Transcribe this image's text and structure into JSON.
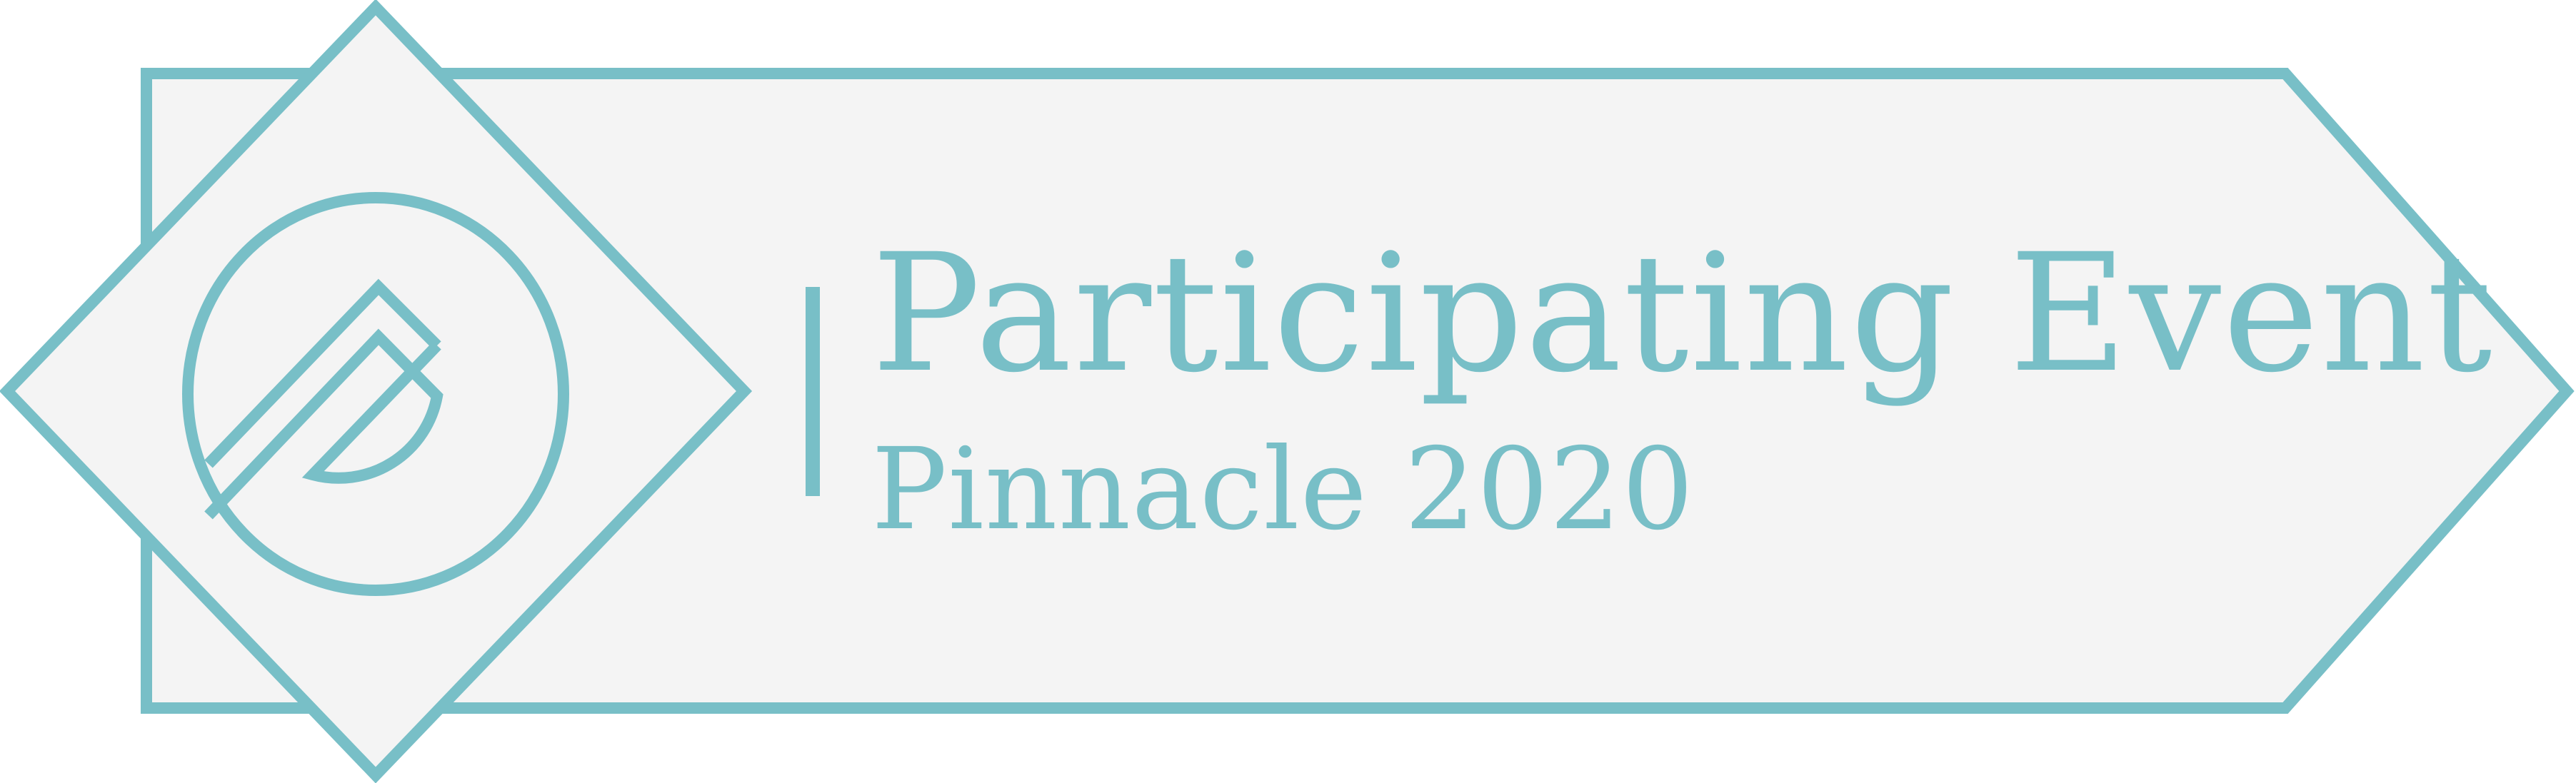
{
  "badge": {
    "title": "Participating Event",
    "subtitle": "Pinnacle 2020",
    "logo_icon": "pinnacle-logo-icon"
  },
  "colors": {
    "accent": "#78bfc7",
    "background": "#f4f4f4",
    "page": "#ffffff"
  }
}
